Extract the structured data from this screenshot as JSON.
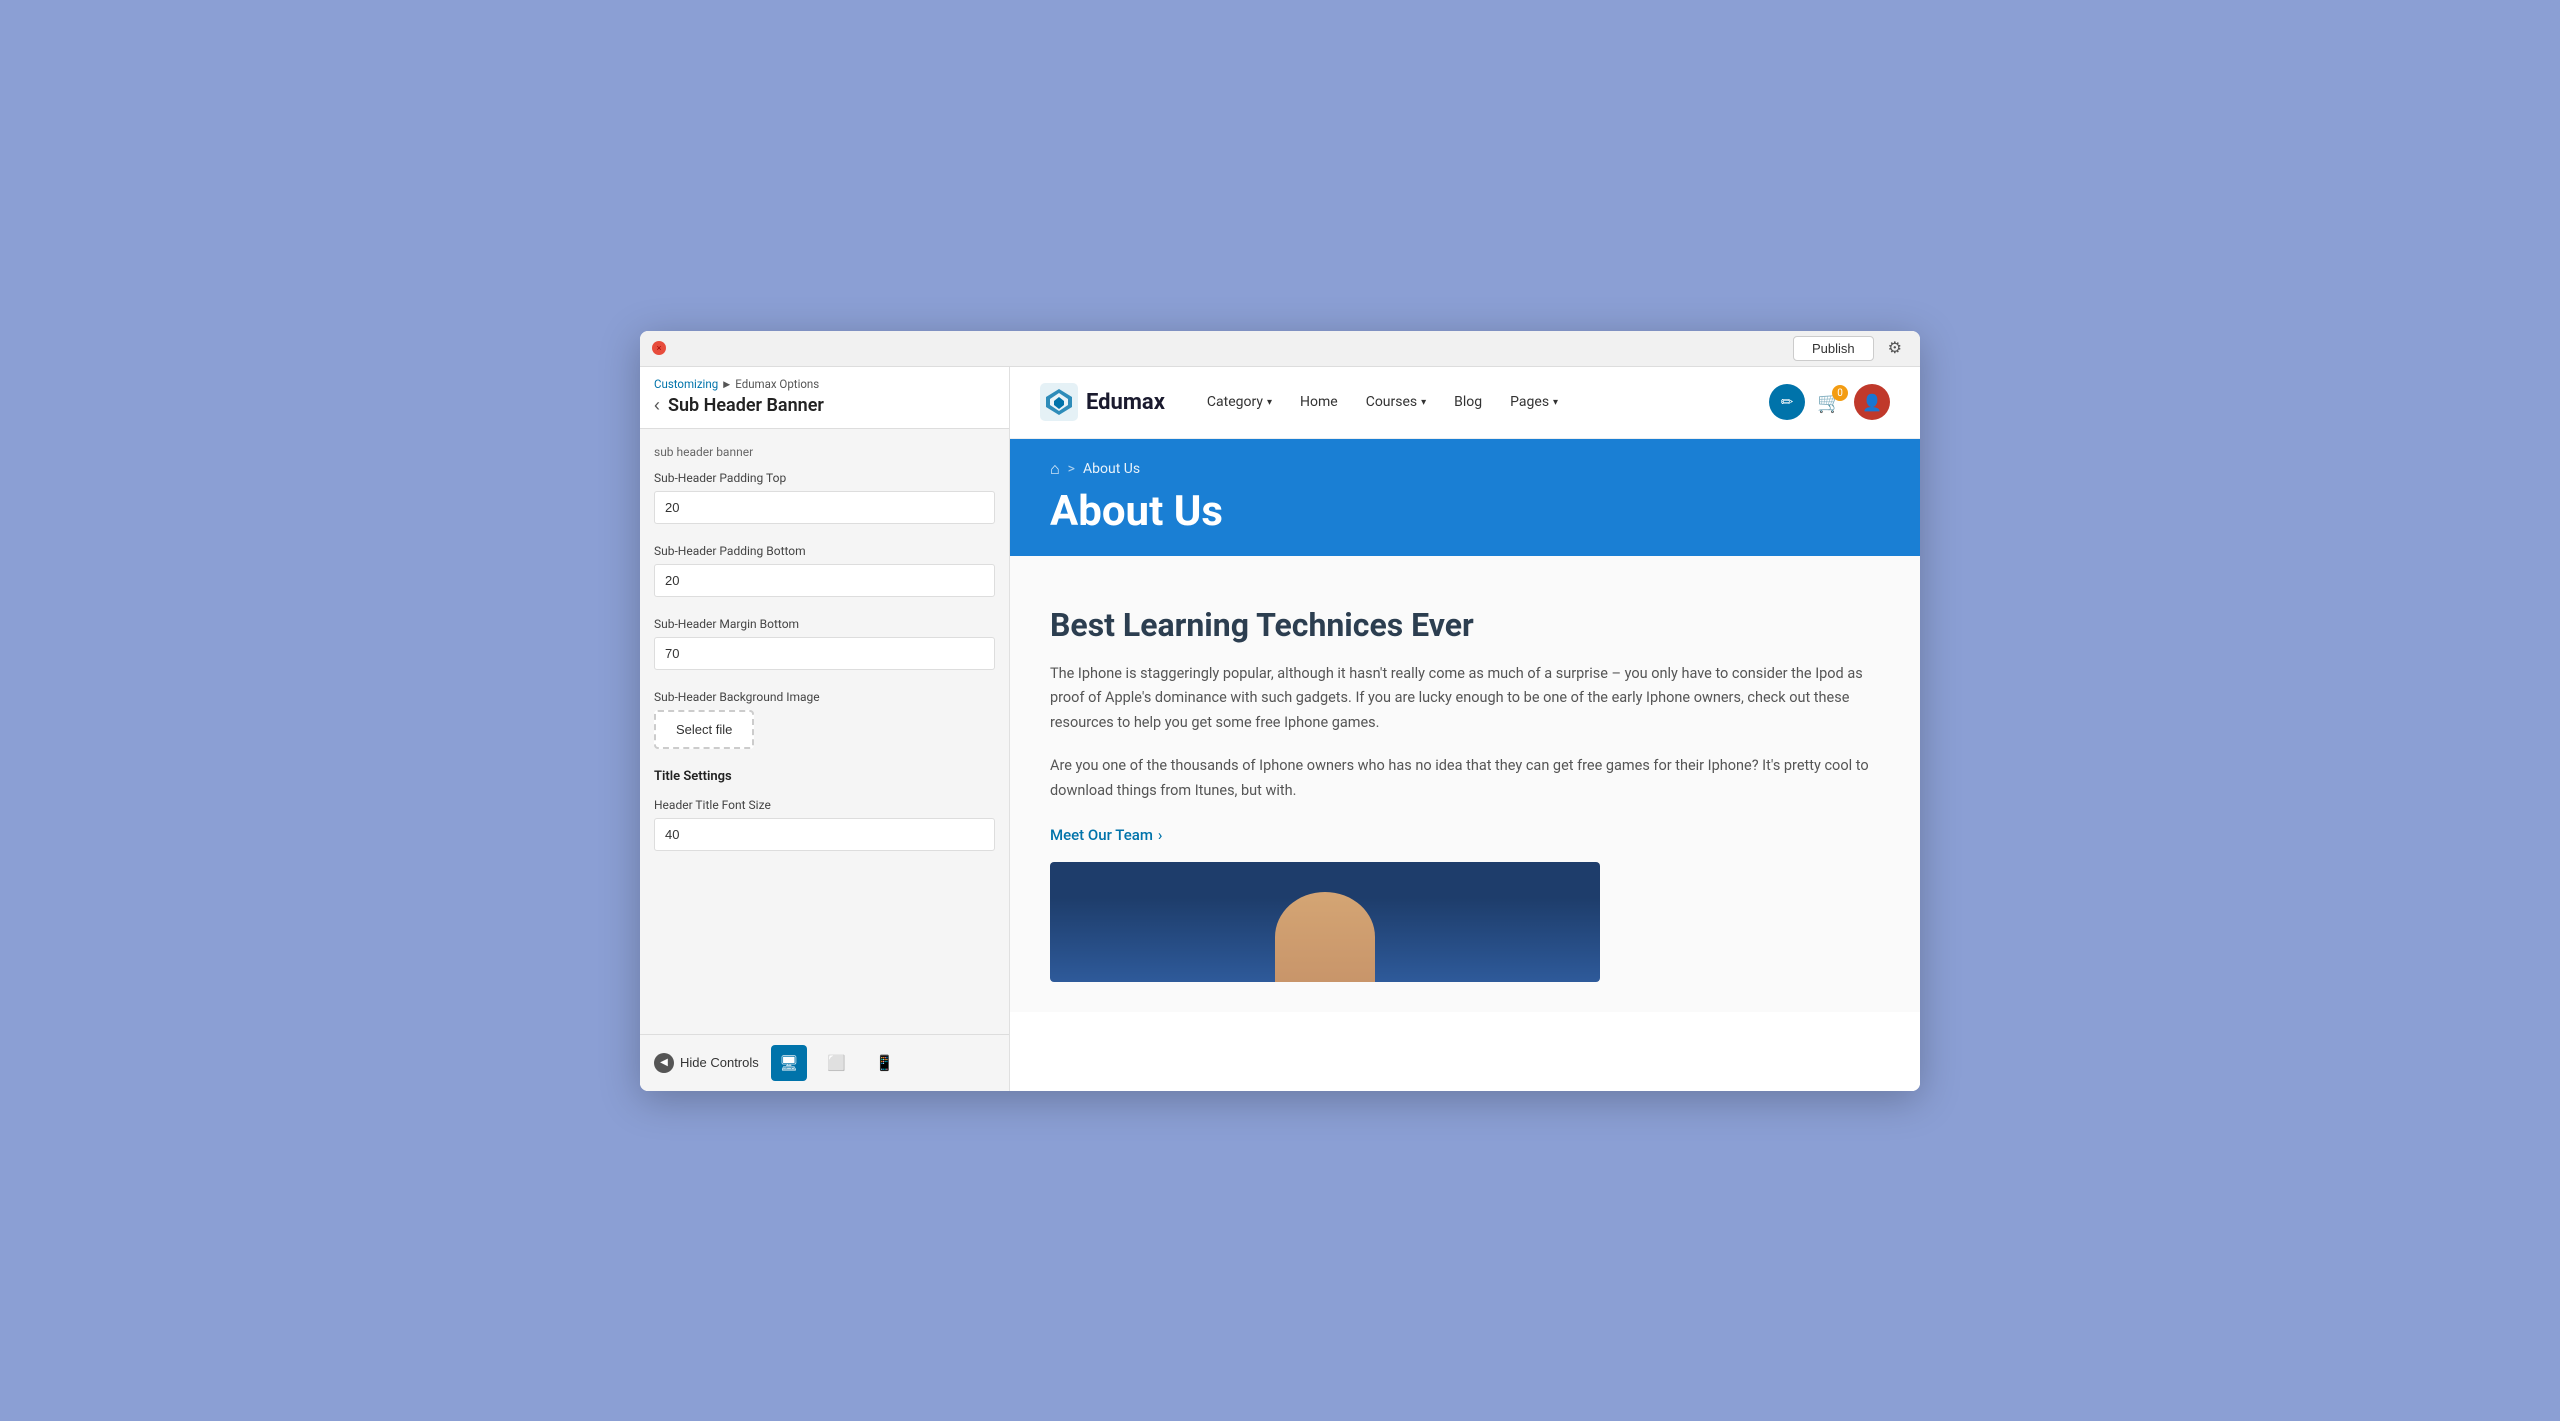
{
  "topbar": {
    "close_label": "×",
    "publish_label": "Publish",
    "settings_label": "⚙"
  },
  "sidebar": {
    "breadcrumb_customizing": "Customizing",
    "breadcrumb_sep": "►",
    "breadcrumb_options": "Edumax Options",
    "back_arrow": "‹",
    "title": "Sub Header Banner",
    "section_label": "sub header banner",
    "fields": [
      {
        "id": "padding_top",
        "label": "Sub-Header Padding Top",
        "value": "20"
      },
      {
        "id": "padding_bottom",
        "label": "Sub-Header Padding Bottom",
        "value": "20"
      },
      {
        "id": "margin_bottom",
        "label": "Sub-Header Margin Bottom",
        "value": "70"
      }
    ],
    "bg_image_label": "Sub-Header Background Image",
    "select_file_label": "Select file",
    "title_settings_label": "Title Settings",
    "header_title_font_size_label": "Header Title Font Size",
    "header_title_font_size_value": "40",
    "footer": {
      "hide_controls_label": "Hide Controls",
      "desktop_icon": "🖥",
      "tablet_icon": "⬜",
      "mobile_icon": "📱"
    }
  },
  "site_header": {
    "logo_text": "Edumax",
    "nav_items": [
      {
        "label": "Category",
        "has_dropdown": true
      },
      {
        "label": "Home",
        "has_dropdown": false
      },
      {
        "label": "Courses",
        "has_dropdown": true
      },
      {
        "label": "Blog",
        "has_dropdown": false
      },
      {
        "label": "Pages",
        "has_dropdown": true
      }
    ],
    "cart_count": "0",
    "edit_icon": "✏"
  },
  "sub_header": {
    "breadcrumb_home_icon": "⌂",
    "breadcrumb_sep": ">",
    "breadcrumb_text": "About Us",
    "page_title": "About Us"
  },
  "page_content": {
    "heading": "Best Learning Technices Ever",
    "paragraph1": "The Iphone is staggeringly popular, although it hasn't really come as much of a surprise – you only have to consider the Ipod as proof of Apple's dominance with such gadgets. If you are lucky enough to be one of the early Iphone owners, check out these resources to help you get some free Iphone games.",
    "paragraph2": "Are you one of the thousands of Iphone owners who has no idea that they can get free games for their Iphone? It's pretty cool to download things from Itunes, but with.",
    "meet_team_label": "Meet Our Team",
    "meet_team_icon": "›"
  }
}
